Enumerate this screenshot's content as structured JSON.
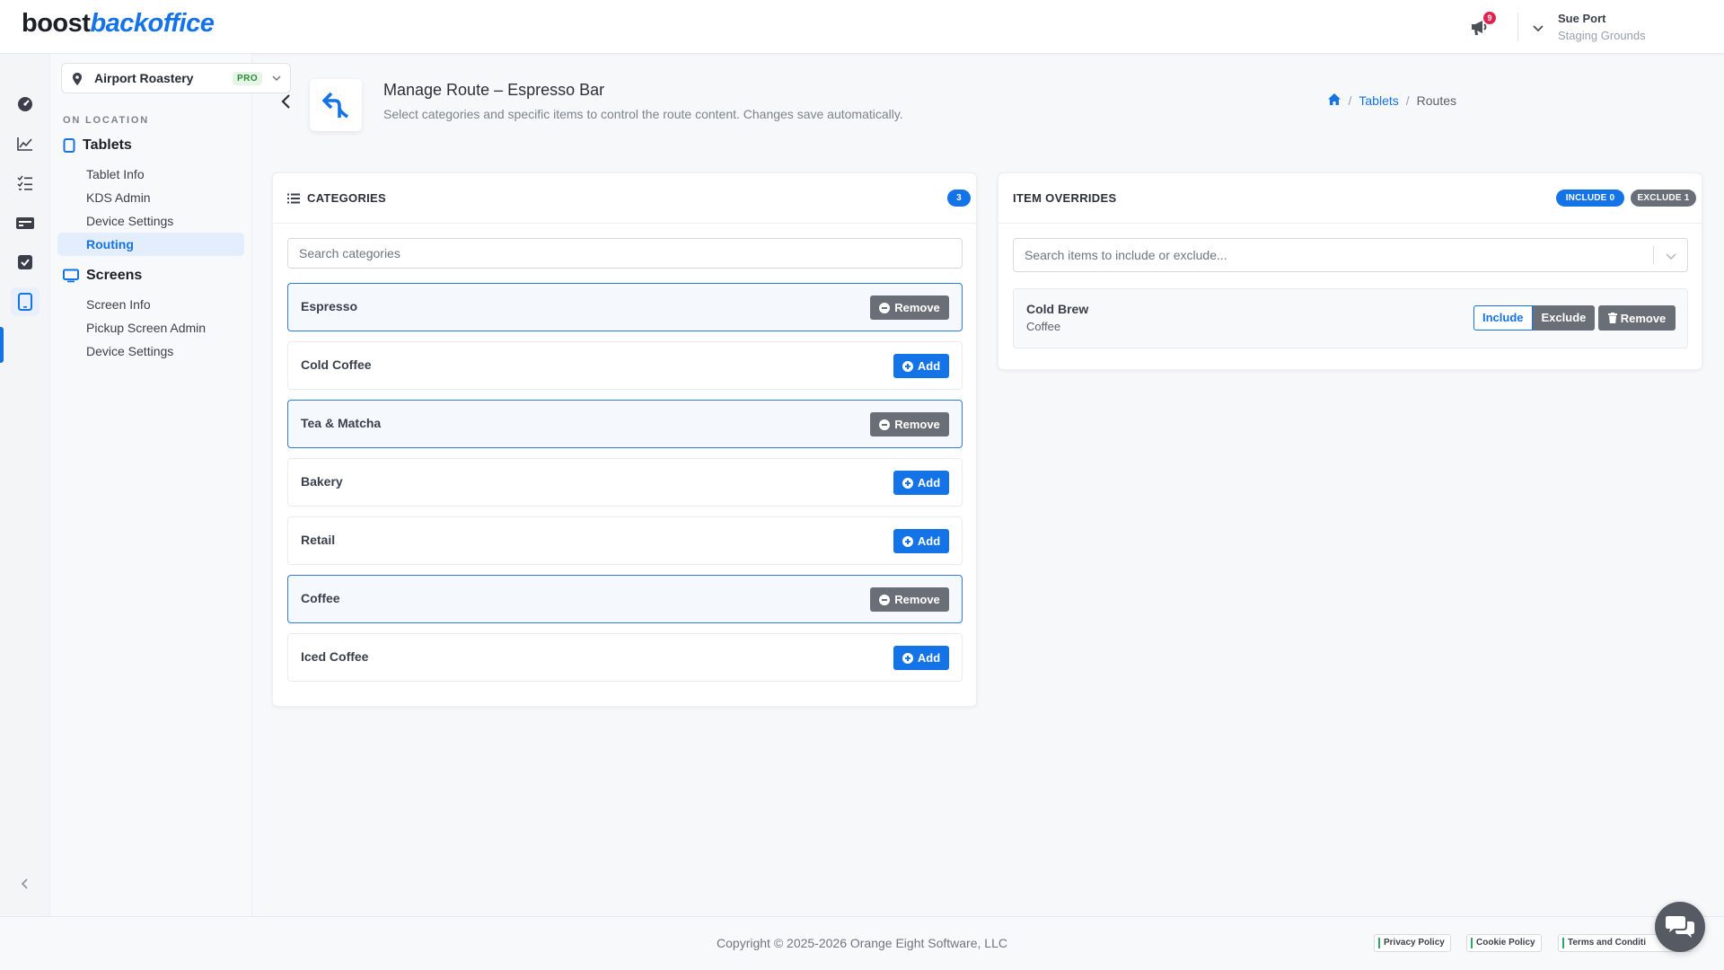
{
  "brand": {
    "logo_part1": "boost",
    "logo_part2": "backoffice"
  },
  "header": {
    "notification_count": "9",
    "user_name": "Sue Port",
    "user_subtitle": "Staging Grounds"
  },
  "location": {
    "name": "Airport Roastery",
    "tier": "PRO"
  },
  "sidebar": {
    "section_label": "ON LOCATION",
    "groups": [
      {
        "title": "Tablets",
        "items": [
          "Tablet Info",
          "KDS Admin",
          "Device Settings",
          "Routing"
        ]
      },
      {
        "title": "Screens",
        "items": [
          "Screen Info",
          "Pickup Screen Admin",
          "Device Settings"
        ]
      }
    ],
    "active_item": "Routing"
  },
  "page": {
    "title": "Manage Route – Espresso Bar",
    "subtitle": "Select categories and specific items to control the route content. Changes save automatically.",
    "breadcrumb": {
      "home": "home",
      "link": "Tablets",
      "current": "Routes"
    }
  },
  "categories_card": {
    "title": "CATEGORIES",
    "count": "3",
    "search_placeholder": "Search categories",
    "remove_label": "Remove",
    "add_label": "Add",
    "rows": [
      {
        "name": "Espresso",
        "selected": true
      },
      {
        "name": "Cold Coffee",
        "selected": false
      },
      {
        "name": "Tea & Matcha",
        "selected": true
      },
      {
        "name": "Bakery",
        "selected": false
      },
      {
        "name": "Retail",
        "selected": false
      },
      {
        "name": "Coffee",
        "selected": true
      },
      {
        "name": "Iced Coffee",
        "selected": false
      }
    ]
  },
  "overrides_card": {
    "title": "ITEM OVERRIDES",
    "include_pill": "INCLUDE 0",
    "exclude_pill": "EXCLUDE 1",
    "search_placeholder": "Search items to include or exclude...",
    "items": [
      {
        "name": "Cold Brew",
        "category": "Coffee",
        "include_label": "Include",
        "exclude_label": "Exclude",
        "remove_label": "Remove",
        "mode": "Exclude"
      }
    ]
  },
  "footer": {
    "copyright": "Copyright © 2025-2026 Orange Eight Software, LLC",
    "links": [
      "Privacy Policy",
      "Cookie Policy",
      "Terms and Conditi"
    ]
  },
  "colors": {
    "accent": "#1473e6",
    "muted_button": "#6a6f77",
    "badge_red": "#e02450"
  }
}
